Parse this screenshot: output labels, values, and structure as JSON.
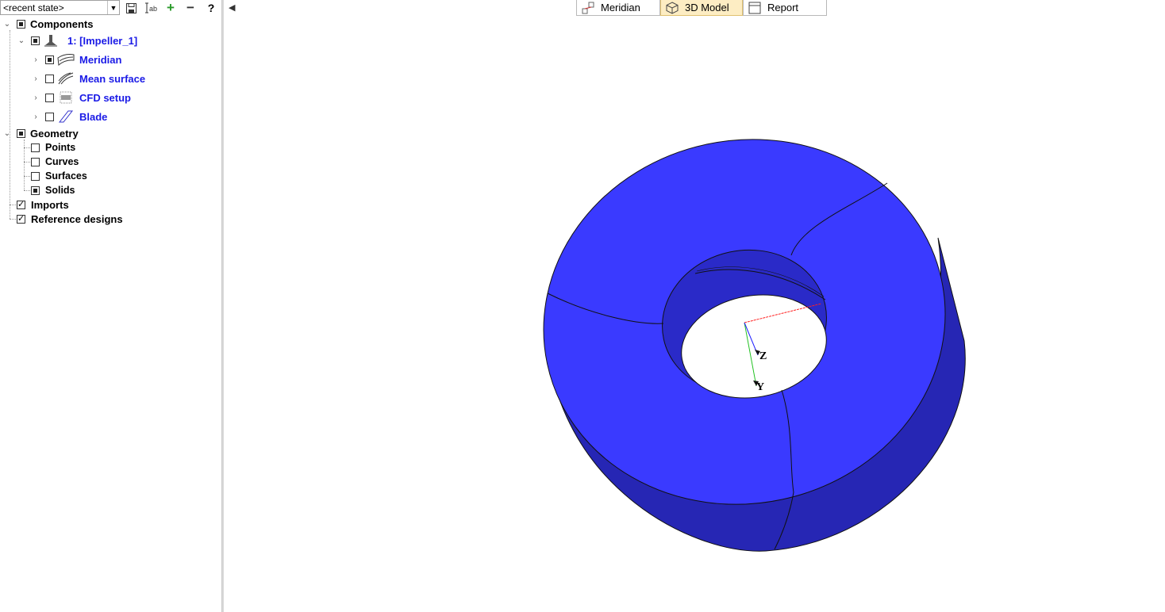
{
  "toolbar": {
    "state_combo_value": "<recent state>",
    "icons": [
      "save-icon",
      "rename-icon",
      "add-icon",
      "remove-icon",
      "help-icon"
    ],
    "help_label": "?"
  },
  "tree": {
    "components": "Components",
    "impeller": "1: [Impeller_1]",
    "meridian": "Meridian",
    "mean_surface": "Mean surface",
    "cfd_setup": "CFD setup",
    "blade": "Blade",
    "geometry": "Geometry",
    "points": "Points",
    "curves": "Curves",
    "surfaces": "Surfaces",
    "solids": "Solids",
    "imports": "Imports",
    "reference_designs": "Reference designs"
  },
  "tabs": [
    {
      "label": "Meridian",
      "icon": "meridian-icon",
      "active": false
    },
    {
      "label": "3D Model",
      "icon": "cube-icon",
      "active": true
    },
    {
      "label": "Report",
      "icon": "report-icon",
      "active": false
    }
  ],
  "viewport": {
    "axis_z": "Z",
    "axis_y": "Y",
    "model_color": "#3a3aff",
    "model_side_color": "#2525b8"
  }
}
